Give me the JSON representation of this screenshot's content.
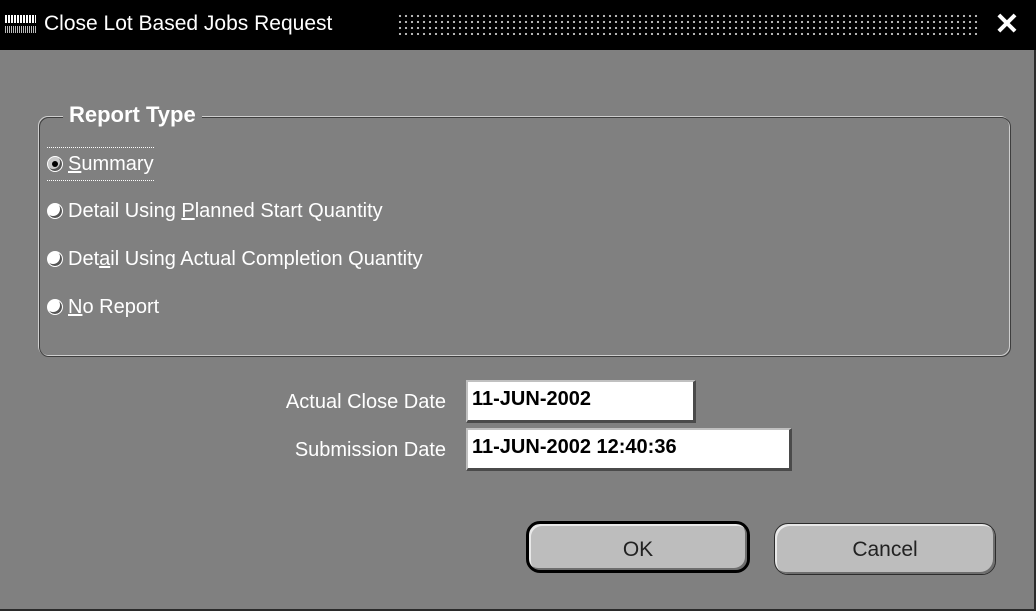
{
  "window": {
    "title": "Close Lot Based Jobs Request",
    "close_glyph": "✕",
    "logo_icon": "oracle-applications-logo-icon"
  },
  "report_type": {
    "legend": "Report Type",
    "options": [
      {
        "pre": "",
        "mnemonic": "S",
        "post": "ummary",
        "selected": true
      },
      {
        "pre": "Detail Using ",
        "mnemonic": "P",
        "post": "lanned Start Quantity",
        "selected": false
      },
      {
        "pre": "Det",
        "mnemonic": "a",
        "post": "il Using Actual Completion Quantity",
        "selected": false
      },
      {
        "pre": "",
        "mnemonic": "N",
        "post": "o Report",
        "selected": false
      }
    ]
  },
  "fields": {
    "actual_close_date": {
      "label": "Actual Close Date",
      "value": "11-JUN-2002"
    },
    "submission_date": {
      "label": "Submission Date",
      "value": "11-JUN-2002 12:40:36"
    }
  },
  "buttons": {
    "ok": "OK",
    "cancel": "Cancel"
  }
}
